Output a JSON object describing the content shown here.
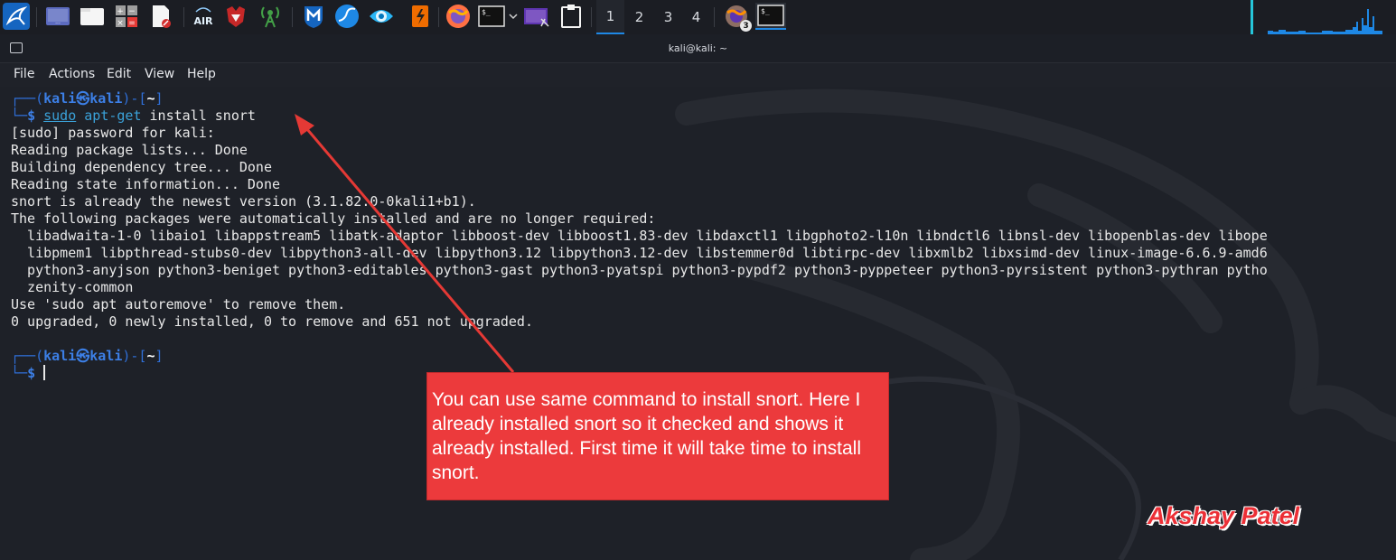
{
  "taskbar": {
    "apps": [
      {
        "name": "kali-menu-icon"
      },
      {
        "name": "workspace-show-desktop-icon"
      },
      {
        "name": "file-manager-icon"
      },
      {
        "name": "calculator-icon"
      },
      {
        "name": "text-editor-icon"
      },
      {
        "name": "aircrack-icon",
        "label": "AIR"
      },
      {
        "name": "burpsuite-icon"
      },
      {
        "name": "wifi-tool-icon"
      },
      {
        "name": "metasploit-icon"
      },
      {
        "name": "wireshark-icon"
      },
      {
        "name": "zaproxy-icon"
      },
      {
        "name": "burp-orange-icon"
      },
      {
        "name": "firefox-icon"
      },
      {
        "name": "terminal-icon"
      },
      {
        "name": "screenshot-icon"
      },
      {
        "name": "clipboard-icon"
      }
    ],
    "workspaces": [
      "1",
      "2",
      "3",
      "4"
    ],
    "running_badge": "3",
    "accent": "#1e88e5"
  },
  "window": {
    "title": "kali@kali: ~"
  },
  "menu": [
    "File",
    "Actions",
    "Edit",
    "View",
    "Help"
  ],
  "terminal": {
    "prompt": {
      "frame_top": "┌──(",
      "user": "kali㉿kali",
      "mid": ")-[",
      "path": "~",
      "end": "]",
      "frame_bottom": "└─",
      "dollar": "$"
    },
    "command": {
      "sudo": "sudo",
      "bin": "apt-get",
      "args": " install snort"
    },
    "output": [
      "[sudo] password for kali:",
      "Reading package lists... Done",
      "Building dependency tree... Done",
      "Reading state information... Done",
      "snort is already the newest version (3.1.82.0-0kali1+b1).",
      "The following packages were automatically installed and are no longer required:",
      "  libadwaita-1-0 libaio1 libappstream5 libatk-adaptor libboost-dev libboost1.83-dev libdaxctl1 libgphoto2-l10n libndctl6 libnsl-dev libopenblas-dev libope",
      "  libpmem1 libpthread-stubs0-dev libpython3-all-dev libpython3.12 libpython3.12-dev libstemmer0d libtirpc-dev libxmlb2 libxsimd-dev linux-image-6.6.9-amd6",
      "  python3-anyjson python3-beniget python3-editables python3-gast python3-pyatspi python3-pypdf2 python3-pyppeteer python3-pyrsistent python3-pythran pytho",
      "  zenity-common",
      "Use 'sudo apt autoremove' to remove them.",
      "0 upgraded, 0 newly installed, 0 to remove and 651 not upgraded."
    ]
  },
  "annotation": {
    "text": "You can use same command to install snort. Here I already installed snort so it checked and shows it already installed. First time it will take time to install snort.",
    "color": "#ec3a3c"
  },
  "watermark": "Akshay Patel"
}
